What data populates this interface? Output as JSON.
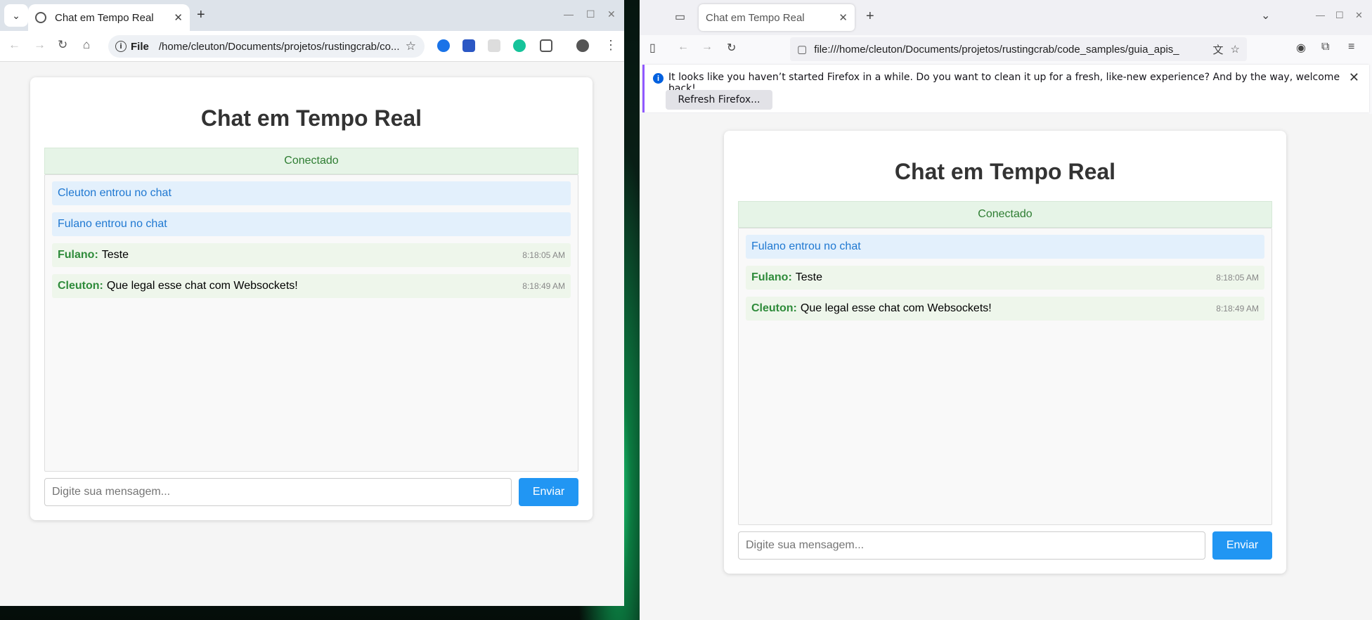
{
  "chrome": {
    "tab_title": "Chat em Tempo Real",
    "tab_close": "✕",
    "new_tab": "+",
    "scheme_label": "File",
    "url": "/home/cleuton/Documents/projetos/rustingcrab/co..."
  },
  "firefox": {
    "tab_title": "Chat em Tempo Real",
    "tab_close": "✕",
    "new_tab": "+",
    "url": "file:///home/cleuton/Documents/projetos/rustingcrab/code_samples/guia_apis_",
    "notice_text": "It looks like you haven’t started Firefox in a while. Do you want to clean it up for a fresh, like-new experience? And by the way, welcome back!",
    "notice_button": "Refresh Firefox..."
  },
  "chat_left": {
    "title": "Chat em Tempo Real",
    "status": "Conectado",
    "messages": [
      {
        "type": "system",
        "text": "Cleuton entrou no chat"
      },
      {
        "type": "system",
        "text": "Fulano entrou no chat"
      },
      {
        "type": "user",
        "user": "Fulano:",
        "text": "Teste",
        "time": "8:18:05 AM"
      },
      {
        "type": "user",
        "user": "Cleuton:",
        "text": "Que legal esse chat com Websockets!",
        "time": "8:18:49 AM"
      }
    ],
    "input_placeholder": "Digite sua mensagem...",
    "send_label": "Enviar"
  },
  "chat_right": {
    "title": "Chat em Tempo Real",
    "status": "Conectado",
    "messages": [
      {
        "type": "system",
        "text": "Fulano entrou no chat"
      },
      {
        "type": "user",
        "user": "Fulano:",
        "text": "Teste",
        "time": "8:18:05 AM"
      },
      {
        "type": "user",
        "user": "Cleuton:",
        "text": "Que legal esse chat com Websockets!",
        "time": "8:18:49 AM"
      }
    ],
    "input_placeholder": "Digite sua mensagem...",
    "send_label": "Enviar"
  }
}
